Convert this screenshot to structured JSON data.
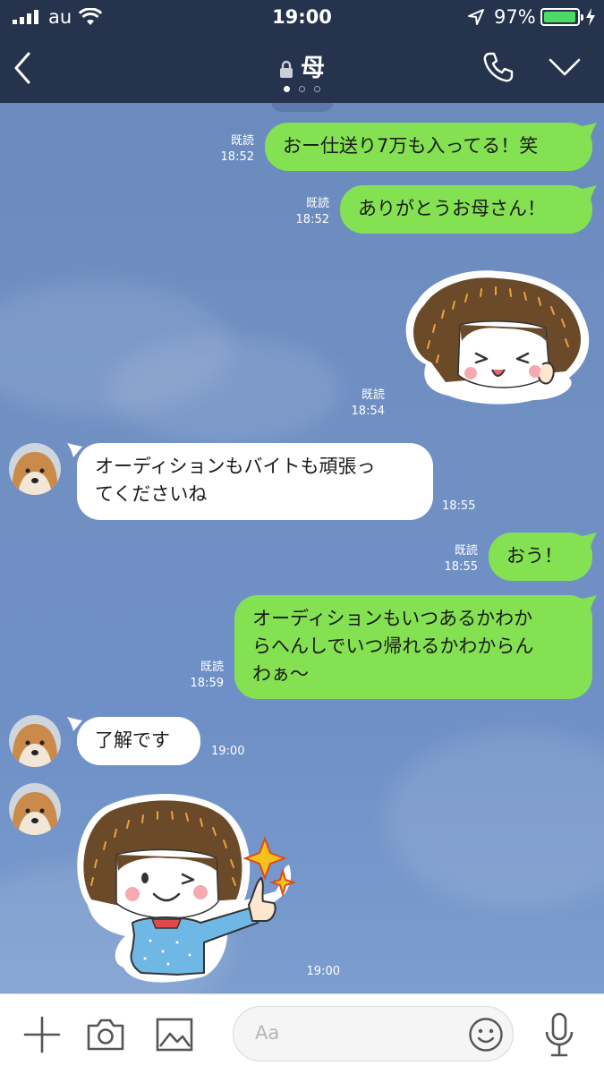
{
  "status": {
    "carrier": "au",
    "time": "19:00",
    "battery_pct": "97%",
    "battery_level": 0.97,
    "battery_color": "#4cd964"
  },
  "header": {
    "title": "母",
    "page_dots": 3,
    "active_dot": 0
  },
  "messages": [
    {
      "side": "me",
      "type": "text",
      "text": "おー仕送り7万も入ってる！笑",
      "read": "既読",
      "time": "18:52"
    },
    {
      "side": "me",
      "type": "text",
      "text": "ありがとうお母さん！",
      "read": "既読",
      "time": "18:52"
    },
    {
      "side": "me",
      "type": "sticker",
      "sticker": "girl-wink-happy-sticker",
      "read": "既読",
      "time": "18:54"
    },
    {
      "side": "them",
      "type": "text",
      "lines": [
        "オーディションもバイトも頑張っ",
        "てくださいね"
      ],
      "time": "18:55"
    },
    {
      "side": "me",
      "type": "text",
      "text": "おう！",
      "read": "既読",
      "time": "18:55"
    },
    {
      "side": "me",
      "type": "text",
      "lines": [
        "オーディションもいつあるかわか",
        "らへんしでいつ帰れるかわからん",
        "わぁ〜"
      ],
      "read": "既読",
      "time": "18:59"
    },
    {
      "side": "them",
      "type": "text",
      "text": "了解です",
      "time": "19:00"
    },
    {
      "side": "them",
      "type": "sticker",
      "sticker": "girl-thumbs-up-sticker",
      "time": "19:00"
    }
  ],
  "input": {
    "placeholder": "Aa"
  },
  "colors": {
    "header": "#26334d",
    "my_bubble": "#84e152",
    "their_bubble": "#ffffff",
    "chat_bg": "#6f8fc0"
  }
}
